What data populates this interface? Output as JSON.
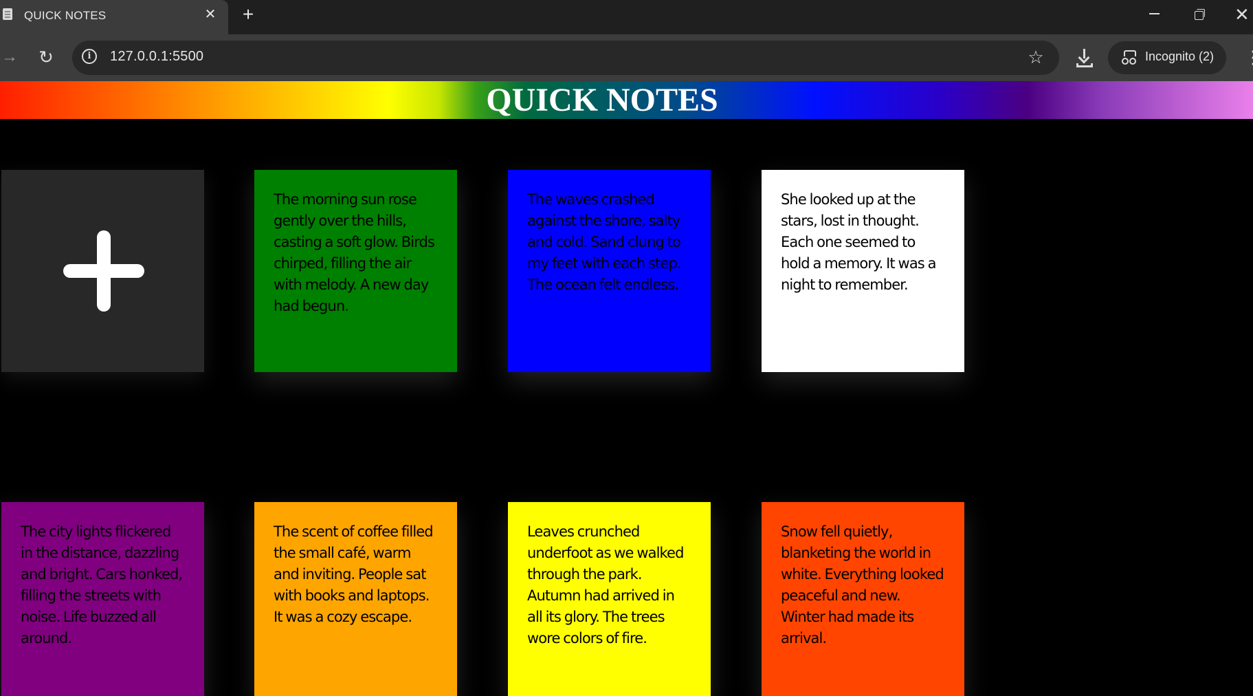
{
  "browser": {
    "tab_title": "QUICK NOTES",
    "tab_close": "✕",
    "new_tab": "+",
    "url": "127.0.0.1:5500",
    "site_info": "i",
    "incognito_label": "Incognito (2)",
    "forward": "→",
    "reload": "↻",
    "bookmark": "☆",
    "menu": "⋮",
    "window_close": "✕"
  },
  "page": {
    "title": "QUICK NOTES"
  },
  "notes": [
    {
      "text": "The morning sun rose gently over the hills, casting a soft glow. Birds chirped, filling the air with melody. A new day had begun.",
      "color": "#008000"
    },
    {
      "text": "The waves crashed against the shore, salty and cold. Sand clung to my feet with each step. The ocean felt endless.",
      "color": "#0000ff"
    },
    {
      "text": "She looked up at the stars, lost in thought. Each one seemed to hold a memory. It was a night to remember.",
      "color": "#ffffff"
    },
    {
      "text": "The city lights flickered in the distance, dazzling and bright. Cars honked, filling the streets with noise. Life buzzed all around.",
      "color": "#800080"
    },
    {
      "text": "The scent of coffee filled the small café, warm and inviting. People sat with books and laptops. It was a cozy escape.",
      "color": "#ffa500"
    },
    {
      "text": "Leaves crunched underfoot as we walked through the park. Autumn had arrived in all its glory. The trees wore colors of fire.",
      "color": "#ffff00"
    },
    {
      "text": "Snow fell quietly, blanketing the world in white. Everything looked peaceful and new. Winter had made its arrival.",
      "color": "#ff4500"
    }
  ]
}
